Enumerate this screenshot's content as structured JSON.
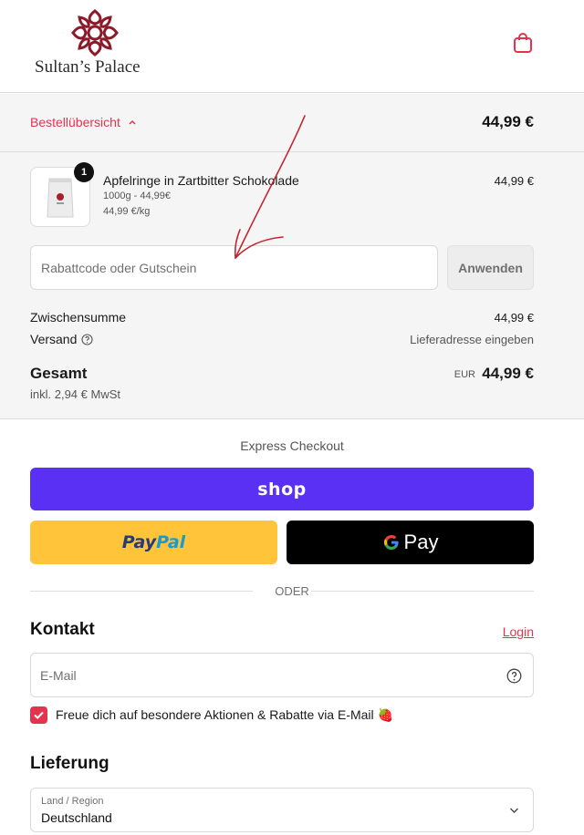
{
  "header": {
    "store_name": "Sultan’s Palace",
    "logo_icon": "ornament-logo-icon",
    "cart_icon": "shopping-bag-icon"
  },
  "summary": {
    "toggle_label": "Bestellübersicht",
    "toggle_total": "44,99 €",
    "product": {
      "quantity": "1",
      "name": "Apfelringe in Zartbitter Schokolade",
      "variant": "1000g - 44,99€",
      "unit_price": "44,99 €/kg",
      "price": "44,99 €"
    },
    "discount": {
      "placeholder": "Rabattcode oder Gutschein",
      "apply_label": "Anwenden"
    },
    "subtotal_label": "Zwischensumme",
    "subtotal_value": "44,99 €",
    "shipping_label": "Versand",
    "shipping_value": "Lieferadresse eingeben",
    "total_label": "Gesamt",
    "tax_label": "inkl. 2,94 € MwSt",
    "currency": "EUR",
    "total_value": "44,99 €"
  },
  "express": {
    "title": "Express Checkout",
    "shop_label": "shop",
    "paypal_label_1": "Pay",
    "paypal_label_2": "Pal",
    "gpay_label": "Pay",
    "divider": "ODER"
  },
  "contact": {
    "title": "Kontakt",
    "login_label": "Login",
    "email_placeholder": "E-Mail",
    "newsletter_label": "Freue dich auf besondere Aktionen & Rabatte via E-Mail 🍓",
    "newsletter_checked": true
  },
  "delivery": {
    "title": "Lieferung",
    "country_caption": "Land / Region",
    "country_value": "Deutschland"
  },
  "colors": {
    "accent": "#e2344e",
    "shop": "#5a31f4",
    "paypal": "#ffc439",
    "annotation": "#c0262d"
  }
}
